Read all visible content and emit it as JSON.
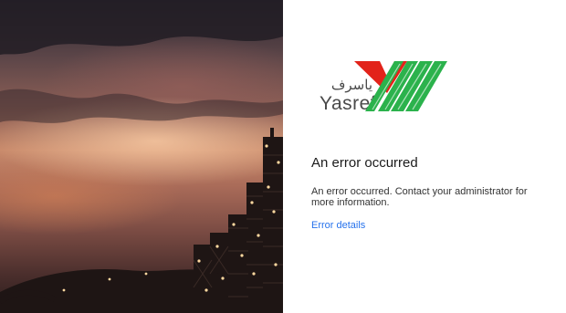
{
  "illustration": {
    "icon": "refinery-sunset-image"
  },
  "logo": {
    "arabic_text": "ياسرف",
    "latin_text": "Yasref",
    "icon": "yasref-logo-mark",
    "colors": {
      "red": "#e2231a",
      "green": "#2bb24c"
    }
  },
  "error": {
    "title": "An error occurred",
    "message": "An error occurred. Contact your administrator for more information.",
    "details_link": "Error details"
  },
  "colors": {
    "link": "#2672ec",
    "text": "#1b1b1b"
  }
}
